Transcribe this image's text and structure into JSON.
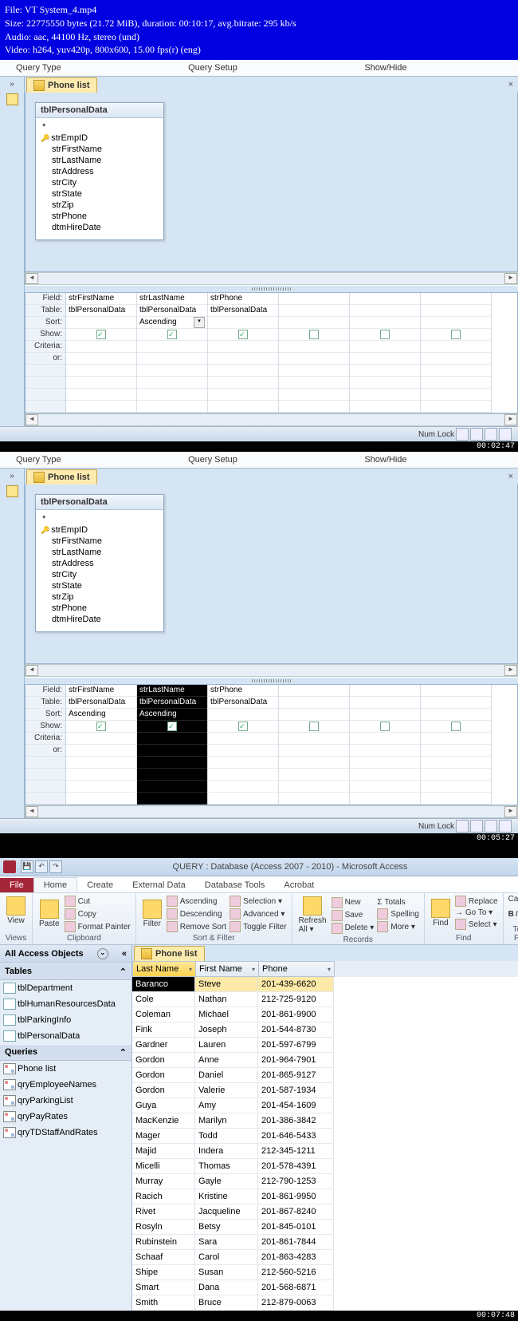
{
  "overlay": {
    "l1": "File: VT System_4.mp4",
    "l2": "Size: 22775550 bytes (21.72 MiB), duration: 00:10:17, avg.bitrate: 295 kb/s",
    "l3": "Audio: aac, 44100 Hz, stereo (und)",
    "l4": "Video: h264, yuv420p, 800x600, 15.00 fps(r) (eng)"
  },
  "ribtabs": {
    "qtype": "Query Type",
    "qsetup": "Query Setup",
    "showhide": "Show/Hide"
  },
  "doc": {
    "title": "Phone list"
  },
  "table": {
    "name": "tblPersonalData",
    "fields": [
      "strEmpID",
      "strFirstName",
      "strLastName",
      "strAddress",
      "strCity",
      "strState",
      "strZip",
      "strPhone",
      "dtmHireDate"
    ]
  },
  "qbe": {
    "labels": [
      "Field:",
      "Table:",
      "Sort:",
      "Show:",
      "Criteria:",
      "or:"
    ],
    "cols1": [
      {
        "field": "strFirstName",
        "table": "tblPersonalData",
        "sort": "",
        "show": true
      },
      {
        "field": "strLastName",
        "table": "tblPersonalData",
        "sort": "Ascending",
        "show": true,
        "dd": true
      },
      {
        "field": "strPhone",
        "table": "tblPersonalData",
        "sort": "",
        "show": true
      },
      {
        "field": "",
        "table": "",
        "sort": "",
        "show": false
      },
      {
        "field": "",
        "table": "",
        "sort": "",
        "show": false
      },
      {
        "field": "",
        "table": "",
        "sort": "",
        "show": false
      }
    ],
    "cols2": [
      {
        "field": "strFirstName",
        "table": "tblPersonalData",
        "sort": "Ascending",
        "show": true
      },
      {
        "field": "strLastName",
        "table": "tblPersonalData",
        "sort": "Ascending",
        "show": true,
        "sel": true
      },
      {
        "field": "strPhone",
        "table": "tblPersonalData",
        "sort": "",
        "show": true
      },
      {
        "field": "",
        "table": "",
        "sort": "",
        "show": false
      },
      {
        "field": "",
        "table": "",
        "sort": "",
        "show": false
      },
      {
        "field": "",
        "table": "",
        "sort": "",
        "show": false
      }
    ]
  },
  "status": {
    "numlock": "Num Lock"
  },
  "ts1": "00:02:47",
  "ts2": "00:05:27",
  "ts3": "00:07:48",
  "win": {
    "title": "QUERY : Database (Access 2007 - 2010) - Microsoft Access",
    "tabs": {
      "file": "File",
      "home": "Home",
      "create": "Create",
      "ext": "External Data",
      "db": "Database Tools",
      "acro": "Acrobat"
    },
    "groups": {
      "views": "Views",
      "clipboard": "Clipboard",
      "sortfilter": "Sort & Filter",
      "records": "Records",
      "find": "Find",
      "textfmt": "Text For"
    },
    "btns": {
      "view": "View",
      "paste": "Paste",
      "cut": "Cut",
      "copy": "Copy",
      "fmt": "Format Painter",
      "filter": "Filter",
      "asc": "Ascending",
      "desc": "Descending",
      "rmsort": "Remove Sort",
      "sel": "Selection ▾",
      "adv": "Advanced ▾",
      "tog": "Toggle Filter",
      "refresh": "Refresh\nAll ▾",
      "new": "New",
      "save": "Save",
      "del": "Delete ▾",
      "totals": "Totals",
      "spell": "Spelling",
      "more": "More ▾",
      "find": "Find",
      "replace": "Replace",
      "goto": "Go To ▾",
      "select": "Select ▾",
      "font": "Calibri"
    }
  },
  "nav": {
    "title": "All Access Objects",
    "tables": {
      "hdr": "Tables",
      "items": [
        "tblDepartment",
        "tblHumanResourcesData",
        "tblParkingInfo",
        "tblPersonalData"
      ]
    },
    "queries": {
      "hdr": "Queries",
      "items": [
        "Phone list",
        "qryEmployeeNames",
        "qryParkingList",
        "qryPayRates",
        "qryTDStaffAndRates"
      ]
    }
  },
  "ds": {
    "cols": [
      "Last Name",
      "First Name",
      "Phone"
    ],
    "rows": [
      [
        "Baranco",
        "Steve",
        "201-439-6620"
      ],
      [
        "Cole",
        "Nathan",
        "212-725-9120"
      ],
      [
        "Coleman",
        "Michael",
        "201-861-9900"
      ],
      [
        "Fink",
        "Joseph",
        "201-544-8730"
      ],
      [
        "Gardner",
        "Lauren",
        "201-597-6799"
      ],
      [
        "Gordon",
        "Anne",
        "201-964-7901"
      ],
      [
        "Gordon",
        "Daniel",
        "201-865-9127"
      ],
      [
        "Gordon",
        "Valerie",
        "201-587-1934"
      ],
      [
        "Guya",
        "Amy",
        "201-454-1609"
      ],
      [
        "MacKenzie",
        "Marilyn",
        "201-386-3842"
      ],
      [
        "Mager",
        "Todd",
        "201-646-5433"
      ],
      [
        "Majid",
        "Indera",
        "212-345-1211"
      ],
      [
        "Micelli",
        "Thomas",
        "201-578-4391"
      ],
      [
        "Murray",
        "Gayle",
        "212-790-1253"
      ],
      [
        "Racich",
        "Kristine",
        "201-861-9950"
      ],
      [
        "Rivet",
        "Jacqueline",
        "201-867-8240"
      ],
      [
        "Rosyln",
        "Betsy",
        "201-845-0101"
      ],
      [
        "Rubinstein",
        "Sara",
        "201-861-7844"
      ],
      [
        "Schaaf",
        "Carol",
        "201-863-4283"
      ],
      [
        "Shipe",
        "Susan",
        "212-560-5216"
      ],
      [
        "Smart",
        "Dana",
        "201-568-6871"
      ],
      [
        "Smith",
        "Bruce",
        "212-879-0063"
      ]
    ]
  }
}
